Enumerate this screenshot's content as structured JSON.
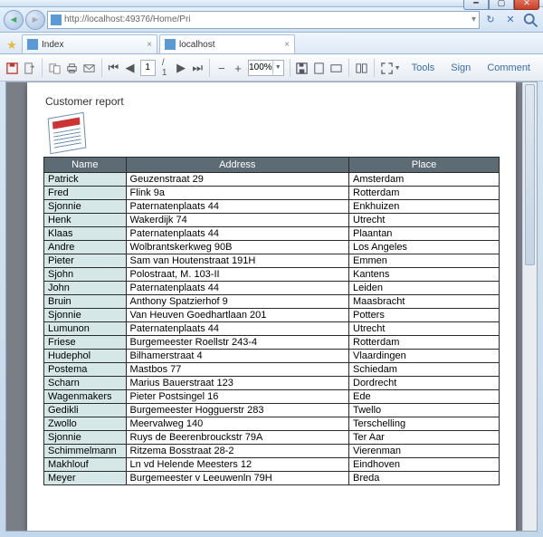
{
  "window": {
    "url": "http://localhost:49376/Home/Pri",
    "tabs": [
      {
        "label": "Index",
        "active": false
      },
      {
        "label": "localhost",
        "active": true
      }
    ]
  },
  "pdf_toolbar": {
    "page_current": "1",
    "page_total": "/ 1",
    "zoom": "100%",
    "links": {
      "tools": "Tools",
      "sign": "Sign",
      "comment": "Comment"
    }
  },
  "report": {
    "title": "Customer report",
    "columns": {
      "name": "Name",
      "address": "Address",
      "place": "Place"
    },
    "rows": [
      {
        "name": "Patrick",
        "address": "Geuzenstraat 29",
        "place": "Amsterdam"
      },
      {
        "name": "Fred",
        "address": "Flink 9a",
        "place": "Rotterdam"
      },
      {
        "name": "Sjonnie",
        "address": "Paternatenplaats 44",
        "place": "Enkhuizen"
      },
      {
        "name": "Henk",
        "address": "Wakerdijk 74",
        "place": "Utrecht"
      },
      {
        "name": "Klaas",
        "address": "Paternatenplaats 44",
        "place": "Plaantan"
      },
      {
        "name": "Andre",
        "address": "Wolbrantskerkweg 90B",
        "place": "Los Angeles"
      },
      {
        "name": "Pieter",
        "address": "Sam van Houtenstraat 191H",
        "place": "Emmen"
      },
      {
        "name": "Sjohn",
        "address": "Polostraat, M. 103-II",
        "place": "Kantens"
      },
      {
        "name": "John",
        "address": "Paternatenplaats 44",
        "place": "Leiden"
      },
      {
        "name": "Bruin",
        "address": "Anthony Spatzierhof 9",
        "place": "Maasbracht"
      },
      {
        "name": "Sjonnie",
        "address": "Van Heuven Goedhartlaan 201",
        "place": "Potters"
      },
      {
        "name": "Lumunon",
        "address": "Paternatenplaats 44",
        "place": "Utrecht"
      },
      {
        "name": "Friese",
        "address": "Burgemeester Roellstr 243-4",
        "place": "Rotterdam"
      },
      {
        "name": "Hudephol",
        "address": "Bilhamerstraat 4",
        "place": "Vlaardingen"
      },
      {
        "name": "Postema",
        "address": "Mastbos 77",
        "place": "Schiedam"
      },
      {
        "name": "Scharn",
        "address": "Marius Bauerstraat 123",
        "place": "Dordrecht"
      },
      {
        "name": "Wagenmakers",
        "address": "Pieter Postsingel 16",
        "place": "Ede"
      },
      {
        "name": "Gedikli",
        "address": "Burgemeester Hogguerstr 283",
        "place": "Twello"
      },
      {
        "name": "Zwollo",
        "address": "Meervalweg 140",
        "place": "Terschelling"
      },
      {
        "name": "Sjonnie",
        "address": "Ruys de Beerenbrouckstr 79A",
        "place": "Ter Aar"
      },
      {
        "name": "Schimmelmann",
        "address": "Ritzema Bosstraat 28-2",
        "place": "Vierenman"
      },
      {
        "name": "Makhlouf",
        "address": "Ln vd Helende Meesters 12",
        "place": "Eindhoven"
      },
      {
        "name": "Meyer",
        "address": "Burgemeester v Leeuwenln 79H",
        "place": "Breda"
      }
    ]
  }
}
